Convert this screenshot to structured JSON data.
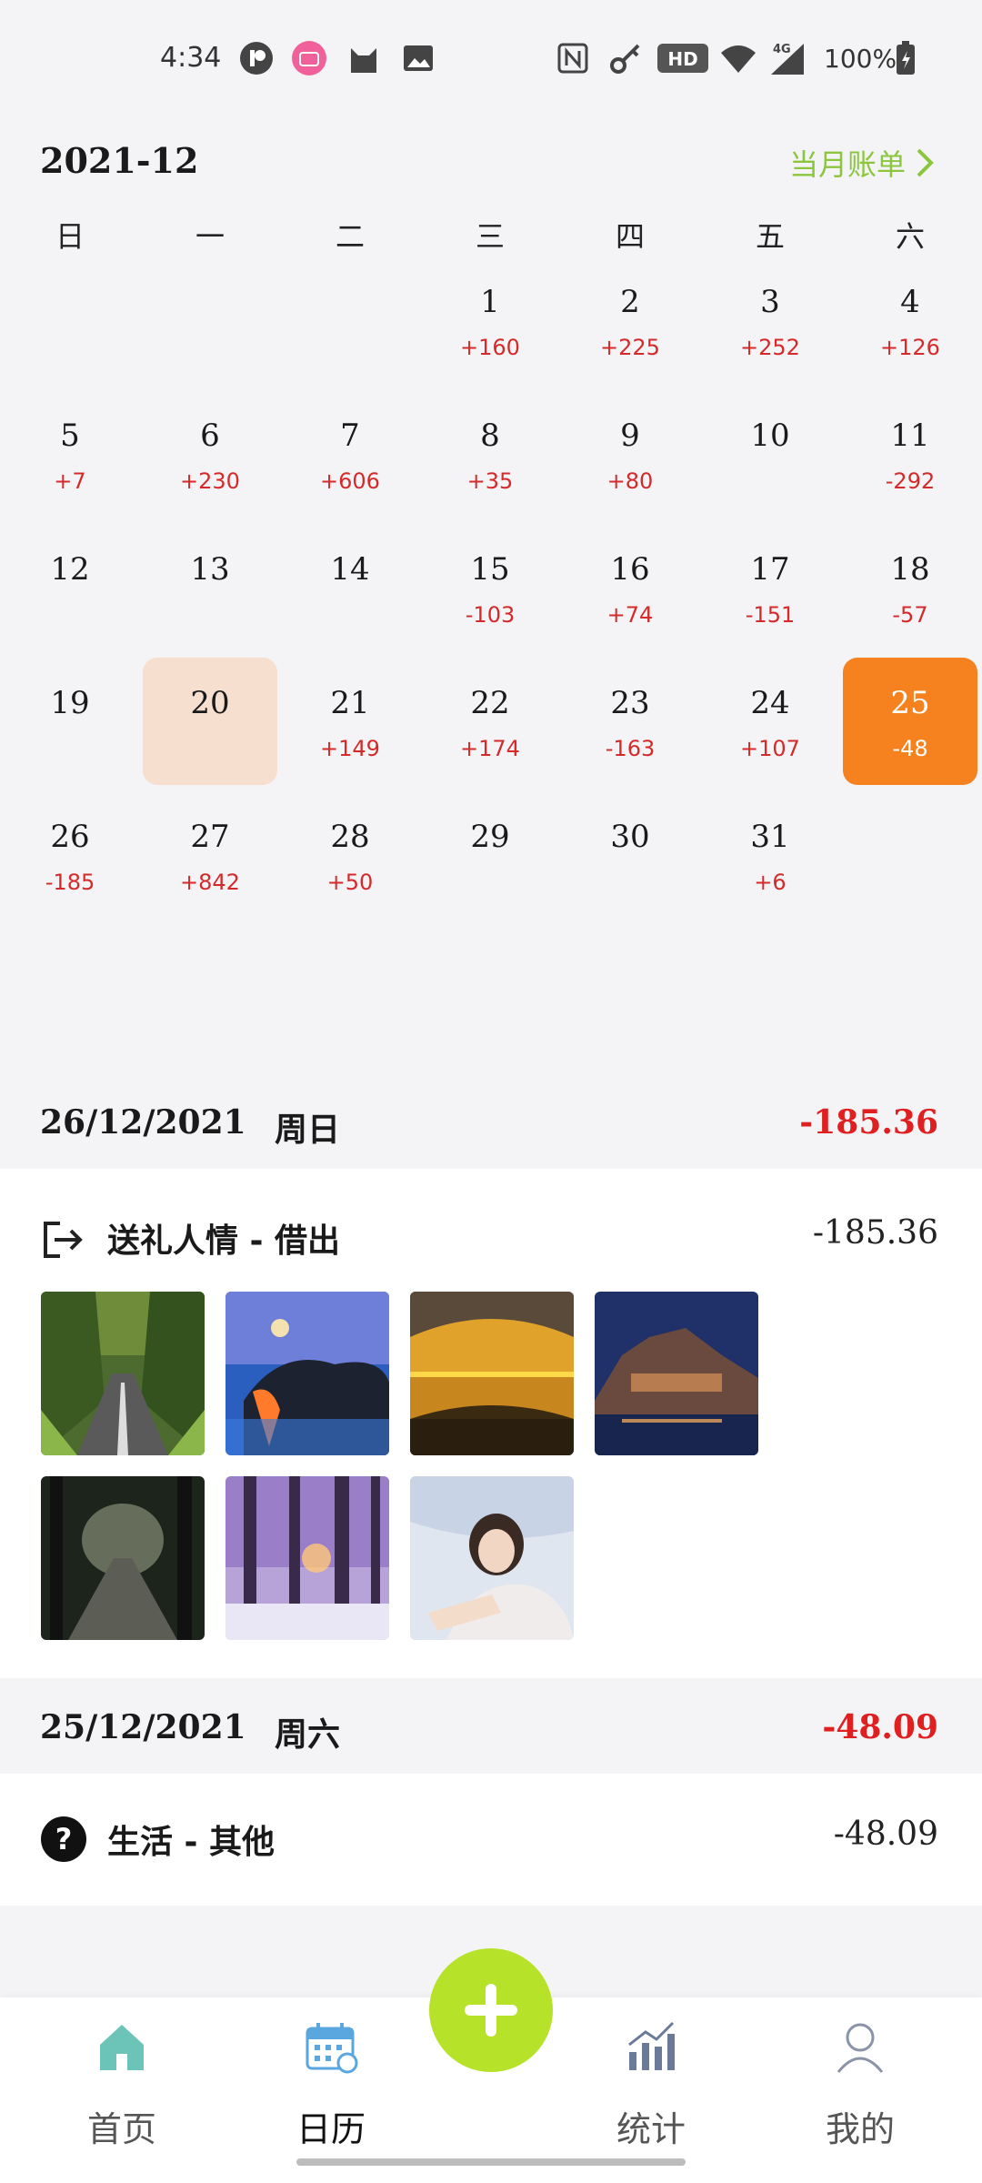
{
  "status_bar": {
    "time": "4:34",
    "network": "4G",
    "battery": "100%",
    "icons": [
      "app-icon-p",
      "bilibili-icon",
      "cat-icon",
      "image-icon",
      "nfc-icon",
      "key-icon",
      "hd-icon",
      "wifi-icon",
      "signal-icon",
      "battery-icon"
    ]
  },
  "calendar": {
    "month": "2021-12",
    "monthly_bill_label": "当月账单",
    "weekdays": [
      "日",
      "一",
      "二",
      "三",
      "四",
      "五",
      "六"
    ],
    "days": [
      {
        "day": "1",
        "amount": "+160"
      },
      {
        "day": "2",
        "amount": "+225"
      },
      {
        "day": "3",
        "amount": "+252"
      },
      {
        "day": "4",
        "amount": "+126"
      },
      {
        "day": "5",
        "amount": "+7"
      },
      {
        "day": "6",
        "amount": "+230"
      },
      {
        "day": "7",
        "amount": "+606"
      },
      {
        "day": "8",
        "amount": "+35"
      },
      {
        "day": "9",
        "amount": "+80"
      },
      {
        "day": "10",
        "amount": ""
      },
      {
        "day": "11",
        "amount": "-292"
      },
      {
        "day": "12",
        "amount": ""
      },
      {
        "day": "13",
        "amount": ""
      },
      {
        "day": "14",
        "amount": ""
      },
      {
        "day": "15",
        "amount": "-103"
      },
      {
        "day": "16",
        "amount": "+74"
      },
      {
        "day": "17",
        "amount": "-151"
      },
      {
        "day": "18",
        "amount": "-57"
      },
      {
        "day": "19",
        "amount": ""
      },
      {
        "day": "20",
        "amount": ""
      },
      {
        "day": "21",
        "amount": "+149"
      },
      {
        "day": "22",
        "amount": "+174"
      },
      {
        "day": "23",
        "amount": "-163"
      },
      {
        "day": "24",
        "amount": "+107"
      },
      {
        "day": "25",
        "amount": "-48"
      },
      {
        "day": "26",
        "amount": "-185"
      },
      {
        "day": "27",
        "amount": "+842"
      },
      {
        "day": "28",
        "amount": "+50"
      },
      {
        "day": "29",
        "amount": ""
      },
      {
        "day": "30",
        "amount": ""
      },
      {
        "day": "31",
        "amount": "+6"
      }
    ],
    "today": "20",
    "selected": "25",
    "colors": {
      "negative": "#d42a2a",
      "today_bg": "#f6dfcf",
      "selected_bg": "#f5821f",
      "accent": "#8cc63f"
    }
  },
  "records": [
    {
      "date": "26/12/2021",
      "weekday": "周日",
      "total": "-185.36",
      "entry": {
        "category": "送礼人情 - 借出",
        "amount": "-185.36",
        "icon": "export-icon"
      },
      "photos": [
        "tree-road-photo",
        "lava-coast-photo",
        "sunset-lake-photo",
        "night-island-photo",
        "forest-path-photo",
        "snow-forest-photo",
        "girl-portrait-photo"
      ]
    },
    {
      "date": "25/12/2021",
      "weekday": "周六",
      "total": "-48.09",
      "entry": {
        "category": "生活 - 其他",
        "amount": "-48.09",
        "icon": "question-icon"
      }
    }
  ],
  "nav": {
    "items": [
      {
        "label": "首页",
        "icon": "home-icon"
      },
      {
        "label": "日历",
        "icon": "calendar-icon"
      },
      {
        "label": "统计",
        "icon": "chart-icon"
      },
      {
        "label": "我的",
        "icon": "profile-icon"
      }
    ],
    "add_icon": "plus-icon"
  }
}
